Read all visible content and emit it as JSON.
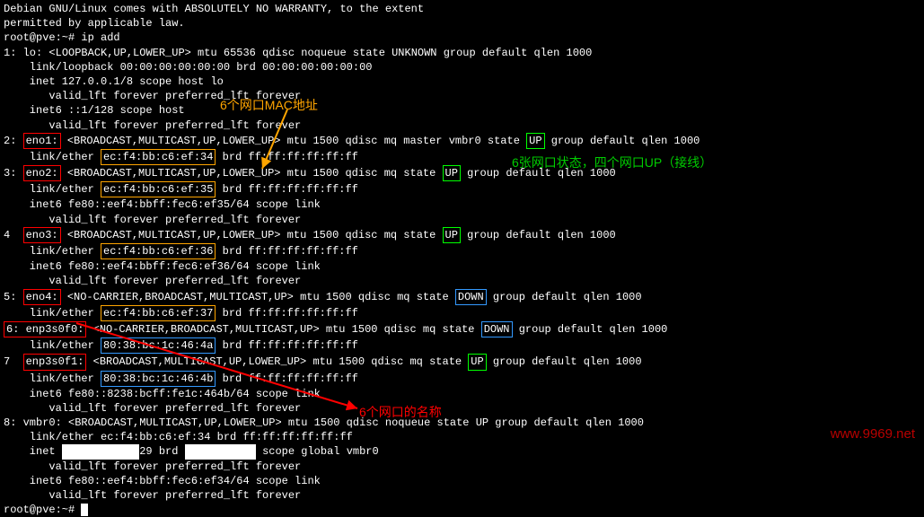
{
  "header": {
    "warranty1": "Debian GNU/Linux comes with ABSOLUTELY NO WARRANTY, to the extent",
    "warranty2": "permitted by applicable law.",
    "prompt1": "root@pve:~# ",
    "cmd1": "ip add",
    "prompt2": "root@pve:~# "
  },
  "annotations": {
    "mac_label": "6个网口MAC地址",
    "status_label": "6张网口状态，四个网口UP（接线）",
    "name_label": "6个网口的名称"
  },
  "watermark": "www.9969.net",
  "interfaces": [
    {
      "idx": "1:",
      "name": "lo:",
      "flags": "<LOOPBACK,UP,LOWER_UP>",
      "tail": " mtu 65536 qdisc noqueue state UNKNOWN group default qlen 1000",
      "link": "    link/loopback 00:00:00:00:00:00 brd 00:00:00:00:00:00",
      "inet": "    inet 127.0.0.1/8 scope host lo",
      "valid": "       valid_lft forever preferred_lft forever",
      "inet6": "    inet6 ::1/128 scope host",
      "valid2": "       valid_lft forever preferred_lft forever"
    },
    {
      "idx": "2:",
      "name": "eno1:",
      "flags": " <BROADCAST,MULTICAST,UP,LOWER_UP>",
      "mid": " mtu 1500 qdisc mq master vmbr0 state ",
      "state": "UP",
      "tail": " group default qlen 1000",
      "link_pre": "    link/ether ",
      "mac": "ec:f4:bb:c6:ef:34",
      "link_post": " brd ff:ff:ff:ff:ff:ff",
      "name_box": "red",
      "mac_box": "orange",
      "state_box": "green"
    },
    {
      "idx": "3:",
      "name": "eno2:",
      "flags": " <BROADCAST,MULTICAST,UP,LOWER_UP>",
      "mid": " mtu 1500 qdisc mq state ",
      "state": "UP",
      "tail": " group default qlen 1000",
      "link_pre": "    link/ether ",
      "mac": "ec:f4:bb:c6:ef:35",
      "link_post": " brd ff:ff:ff:ff:ff:ff",
      "inet6": "    inet6 fe80::eef4:bbff:fec6:ef35/64 scope link",
      "valid": "       valid_lft forever preferred_lft forever",
      "name_box": "red",
      "mac_box": "orange",
      "state_box": "green"
    },
    {
      "idx": "4",
      "name": "eno3:",
      "flags": " <BROADCAST,MULTICAST,UP,LOWER_UP>",
      "mid": " mtu 1500 qdisc mq state ",
      "state": "UP",
      "tail": " group default qlen 1000",
      "link_pre": "    link/ether ",
      "mac": "ec:f4:bb:c6:ef:36",
      "link_post": " brd ff:ff:ff:ff:ff:ff",
      "inet6": "    inet6 fe80::eef4:bbff:fec6:ef36/64 scope link",
      "valid": "       valid_lft forever preferred_lft forever",
      "name_box": "red",
      "mac_box": "orange",
      "state_box": "green"
    },
    {
      "idx": "5:",
      "name": "eno4:",
      "flags": " <NO-CARRIER,BROADCAST,MULTICAST,UP>",
      "mid": " mtu 1500 qdisc mq state ",
      "state": "DOWN",
      "tail": " group default qlen 1000",
      "link_pre": "    link/ether ",
      "mac": "ec:f4:bb:c6:ef:37",
      "link_post": " brd ff:ff:ff:ff:ff:ff",
      "name_box": "red",
      "mac_box": "orange",
      "state_box": "blue"
    },
    {
      "idx": "6:",
      "name": "enp3s0f0:",
      "flags": " <NO-CARRIER,BROADCAST,MULTICAST,UP>",
      "mid": " mtu 1500 qdisc mq state ",
      "state": "DOWN",
      "tail": " group default qlen 1000",
      "link_pre": "    link/ether ",
      "mac": "80:38:bc:1c:46:4a",
      "link_post": " brd ff:ff:ff:ff:ff:ff",
      "name_box": "red",
      "mac_box": "blue",
      "state_box": "blue"
    },
    {
      "idx": "7",
      "name": "enp3s0f1:",
      "flags": " <BROADCAST,MULTICAST,UP,LOWER_UP>",
      "mid": " mtu 1500 qdisc mq state ",
      "state": "UP",
      "tail": " group default qlen 1000",
      "link_pre": "    link/ether ",
      "mac": "80:38:bc:1c:46:4b",
      "link_post": " brd ff:ff:ff:ff:ff:ff",
      "inet6": "    inet6 fe80::8238:bcff:fe1c:464b/64 scope link",
      "valid": "       valid_lft forever preferred_lft forever",
      "name_box": "red",
      "mac_box": "blue",
      "state_box": "green"
    },
    {
      "idx": "8:",
      "name": "vmbr0:",
      "flags": " <BROADCAST,MULTICAST,UP,LOWER_UP>",
      "mid": " mtu 1500 qdisc noqueue state UP group default qlen 1000",
      "link": "    link/ether ec:f4:bb:c6:ef:34 brd ff:ff:ff:ff:ff:ff",
      "inet_pre": "    inet ",
      "inet_redact1": "            ",
      "inet_mid": "29 brd ",
      "inet_redact2": "           ",
      "inet_post": " scope global vmbr0",
      "valid": "       valid_lft forever preferred_lft forever",
      "inet6": "    inet6 fe80::eef4:bbff:fec6:ef34/64 scope link",
      "valid2": "       valid_lft forever preferred_lft forever"
    }
  ]
}
